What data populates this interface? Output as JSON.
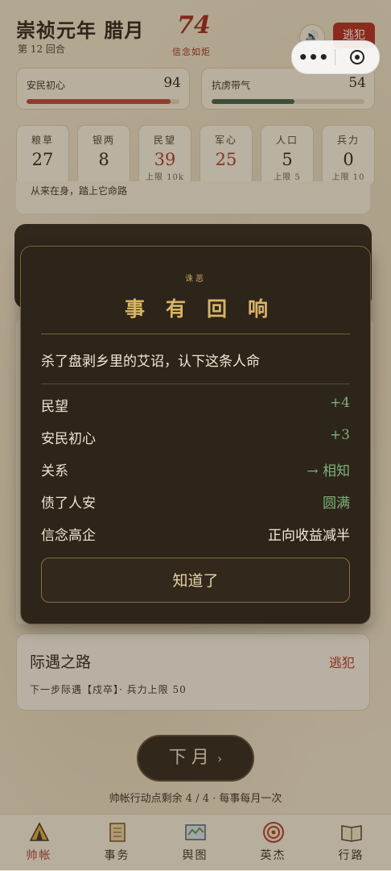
{
  "header": {
    "title": "崇祯元年 腊月",
    "round": "第 12 回合",
    "number": "74",
    "number_sub": "信念如炬",
    "flee_button": "逃犯",
    "sound_icon": "speaker-icon"
  },
  "meters": [
    {
      "label": "安民初心",
      "value": "94",
      "fill": 0.94,
      "color": "#b84533"
    },
    {
      "label": "抗虏带气",
      "value": "54",
      "fill": 0.54,
      "color": "#3f5e43"
    }
  ],
  "stats": [
    {
      "label": "粮草",
      "value": "27",
      "sub": ""
    },
    {
      "label": "银两",
      "value": "8",
      "sub": ""
    },
    {
      "label": "民望",
      "value": "39",
      "sub": "上限 10k"
    },
    {
      "label": "军心",
      "value": "25",
      "sub": ""
    },
    {
      "label": "人口",
      "value": "5",
      "sub": "上限 5"
    },
    {
      "label": "兵力",
      "value": "0",
      "sub": "上限 10"
    }
  ],
  "background_card_text": "从来在身，踏上它命路",
  "modal": {
    "tag": "诛恶",
    "title": "事有回响",
    "description": "杀了盘剥乡里的艾诏，认下这条人命",
    "rows": [
      {
        "key": "民望",
        "value": "+4",
        "style": "green"
      },
      {
        "key": "安民初心",
        "value": "+3",
        "style": "green"
      },
      {
        "key": "关系",
        "value": "→ 相知",
        "style": "green"
      },
      {
        "key": "债了人安",
        "value": "圆满",
        "style": "green"
      },
      {
        "key": "信念高企",
        "value": "正向收益减半",
        "style": "white"
      }
    ],
    "confirm_button": "知道了"
  },
  "route": {
    "title": "际遇之路",
    "tag": "逃犯",
    "subtitle": "下一步际遇【戍卒】· 兵力上限 50"
  },
  "next_button": "下月",
  "action_points": "帅帐行动点剩余 4 / 4 · 每事每月一次",
  "tabs": [
    {
      "label": "帅帐",
      "icon": "tent-icon",
      "active": true
    },
    {
      "label": "事务",
      "icon": "scroll-icon",
      "active": false
    },
    {
      "label": "舆图",
      "icon": "map-icon",
      "active": false
    },
    {
      "label": "英杰",
      "icon": "target-icon",
      "active": false
    },
    {
      "label": "行路",
      "icon": "book-icon",
      "active": false
    }
  ],
  "colors": {
    "accent_red": "#b22a1e",
    "gold": "#d8b467",
    "dark_panel": "#2d241a",
    "positive": "#7fb07a"
  }
}
